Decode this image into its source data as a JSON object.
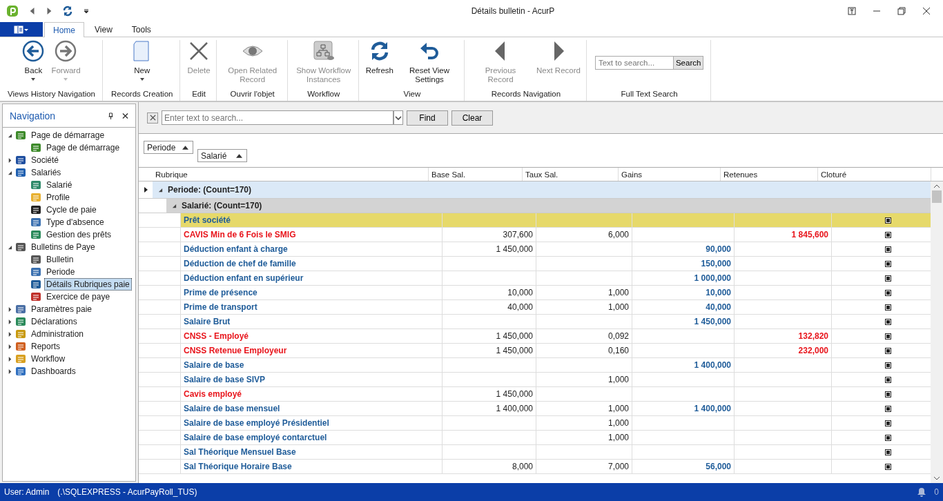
{
  "titlebar": {
    "title": "Détails bulletin - AcurP"
  },
  "ribbon_tabs": [
    {
      "label": "Home",
      "selected": true
    },
    {
      "label": "View",
      "selected": false
    },
    {
      "label": "Tools",
      "selected": false
    }
  ],
  "ribbon_groups": [
    {
      "label": "Views History Navigation",
      "buttons": [
        {
          "label": "Back",
          "disabled": false,
          "dropdown": true
        },
        {
          "label": "Forward",
          "disabled": true,
          "dropdown": true
        }
      ]
    },
    {
      "label": "Records Creation",
      "buttons": [
        {
          "label": "New",
          "disabled": false,
          "dropdown": true
        }
      ]
    },
    {
      "label": "Edit",
      "buttons": [
        {
          "label": "Delete",
          "disabled": true,
          "dropdown": false
        }
      ]
    },
    {
      "label": "Ouvrir l'objet",
      "buttons": [
        {
          "label": "Open Related Record",
          "disabled": true,
          "dropdown": false
        }
      ]
    },
    {
      "label": "Workflow",
      "buttons": [
        {
          "label": "Show Workflow Instances",
          "disabled": true,
          "dropdown": false
        }
      ]
    },
    {
      "label": "View",
      "buttons": [
        {
          "label": "Refresh",
          "disabled": false,
          "dropdown": false
        },
        {
          "label": "Reset View Settings",
          "disabled": false,
          "dropdown": false
        }
      ]
    },
    {
      "label": "Records Navigation",
      "buttons": [
        {
          "label": "Previous Record",
          "disabled": true,
          "dropdown": false
        },
        {
          "label": "Next Record",
          "disabled": true,
          "dropdown": false
        }
      ]
    },
    {
      "label": "Full Text Search",
      "search": {
        "placeholder": "Text to search...",
        "button": "Search"
      }
    }
  ],
  "navigation": {
    "title": "Navigation",
    "items": [
      {
        "label": "Page de démarrage",
        "expanded": true,
        "children": [
          {
            "label": "Page de démarrage",
            "selected": false
          }
        ]
      },
      {
        "label": "Société",
        "expanded": false
      },
      {
        "label": "Salariés",
        "expanded": true,
        "children": [
          {
            "label": "Salarié",
            "selected": false
          },
          {
            "label": "Profile",
            "selected": false
          },
          {
            "label": "Cycle de paie",
            "selected": false
          },
          {
            "label": "Type d'absence",
            "selected": false
          },
          {
            "label": "Gestion des prêts",
            "selected": false
          }
        ]
      },
      {
        "label": "Bulletins de Paye",
        "expanded": true,
        "children": [
          {
            "label": "Bulletin",
            "selected": false
          },
          {
            "label": "Periode",
            "selected": false
          },
          {
            "label": "Détails Rubriques paie",
            "selected": true
          },
          {
            "label": "Exercice de paye",
            "selected": false
          }
        ]
      },
      {
        "label": "Paramètres paie",
        "expanded": false
      },
      {
        "label": "Déclarations",
        "expanded": false
      },
      {
        "label": "Administration",
        "expanded": false
      },
      {
        "label": "Reports",
        "expanded": false
      },
      {
        "label": "Workflow",
        "expanded": false
      },
      {
        "label": "Dashboards",
        "expanded": false
      }
    ]
  },
  "grid": {
    "search": {
      "placeholder": "Enter text to search...",
      "find": "Find",
      "clear": "Clear"
    },
    "group_by": [
      "Periode",
      "Salarié"
    ],
    "columns": [
      "Rubrique",
      "Base Sal.",
      "Taux Sal.",
      "Gains",
      "Retenues",
      "Cloturé"
    ],
    "groups": [
      {
        "label": "Periode: (Count=170)",
        "expanded": true
      },
      {
        "label": "Salarié: (Count=170)",
        "expanded": true
      }
    ],
    "rows": [
      {
        "rubrique": "Prêt société",
        "base": "",
        "taux": "",
        "gains": "",
        "retenues": "",
        "cloture": true,
        "color": "#1f5c99",
        "selected": true
      },
      {
        "rubrique": "CAVIS Min de 6 Fois le SMIG",
        "base": "307,600",
        "taux": "6,000",
        "gains": "",
        "retenues": "1 845,600",
        "cloture": true,
        "color": "#e8141b",
        "selected": false
      },
      {
        "rubrique": "Déduction enfant à charge",
        "base": "1 450,000",
        "taux": "",
        "gains": "90,000",
        "retenues": "",
        "cloture": true,
        "color": "#1f5c99",
        "selected": false
      },
      {
        "rubrique": "Déduction de chef de famille",
        "base": "",
        "taux": "",
        "gains": "150,000",
        "retenues": "",
        "cloture": true,
        "color": "#1f5c99",
        "selected": false
      },
      {
        "rubrique": "Déduction enfant en supérieur",
        "base": "",
        "taux": "",
        "gains": "1 000,000",
        "retenues": "",
        "cloture": true,
        "color": "#1f5c99",
        "selected": false
      },
      {
        "rubrique": "Prime de présence",
        "base": "10,000",
        "taux": "1,000",
        "gains": "10,000",
        "retenues": "",
        "cloture": true,
        "color": "#1f5c99",
        "selected": false
      },
      {
        "rubrique": "Prime de transport",
        "base": "40,000",
        "taux": "1,000",
        "gains": "40,000",
        "retenues": "",
        "cloture": true,
        "color": "#1f5c99",
        "selected": false
      },
      {
        "rubrique": "Salaire Brut",
        "base": "",
        "taux": "",
        "gains": "1 450,000",
        "retenues": "",
        "cloture": true,
        "color": "#1f5c99",
        "selected": false
      },
      {
        "rubrique": "CNSS - Employé",
        "base": "1 450,000",
        "taux": "0,092",
        "gains": "",
        "retenues": "132,820",
        "cloture": true,
        "color": "#e8141b",
        "selected": false
      },
      {
        "rubrique": "CNSS Retenue Employeur",
        "base": "1 450,000",
        "taux": "0,160",
        "gains": "",
        "retenues": "232,000",
        "cloture": true,
        "color": "#e8141b",
        "selected": false
      },
      {
        "rubrique": "Salaire de base",
        "base": "",
        "taux": "",
        "gains": "1 400,000",
        "retenues": "",
        "cloture": true,
        "color": "#1f5c99",
        "selected": false
      },
      {
        "rubrique": "Salaire de base SIVP",
        "base": "",
        "taux": "1,000",
        "gains": "",
        "retenues": "",
        "cloture": true,
        "color": "#1f5c99",
        "selected": false
      },
      {
        "rubrique": "Cavis employé",
        "base": "1 450,000",
        "taux": "",
        "gains": "",
        "retenues": "",
        "cloture": true,
        "color": "#e8141b",
        "selected": false
      },
      {
        "rubrique": "Salaire de base mensuel",
        "base": "1 400,000",
        "taux": "1,000",
        "gains": "1 400,000",
        "retenues": "",
        "cloture": true,
        "color": "#1f5c99",
        "selected": false
      },
      {
        "rubrique": "Salaire de base employé Présidentiel",
        "base": "",
        "taux": "1,000",
        "gains": "",
        "retenues": "",
        "cloture": true,
        "color": "#1f5c99",
        "selected": false
      },
      {
        "rubrique": "Salaire de base employé contarctuel",
        "base": "",
        "taux": "1,000",
        "gains": "",
        "retenues": "",
        "cloture": true,
        "color": "#1f5c99",
        "selected": false
      },
      {
        "rubrique": "Sal Théorique Mensuel Base",
        "base": "",
        "taux": "",
        "gains": "",
        "retenues": "",
        "cloture": true,
        "color": "#1f5c99",
        "selected": false
      },
      {
        "rubrique": "Sal Théorique Horaire Base",
        "base": "8,000",
        "taux": "7,000",
        "gains": "56,000",
        "retenues": "",
        "cloture": true,
        "color": "#1f5c99",
        "selected": false
      }
    ]
  },
  "status_bar": {
    "user": "User: Admin",
    "connection": "(.\\SQLEXPRESS - AcurPayRoll_TUS)",
    "notifications": "0"
  }
}
